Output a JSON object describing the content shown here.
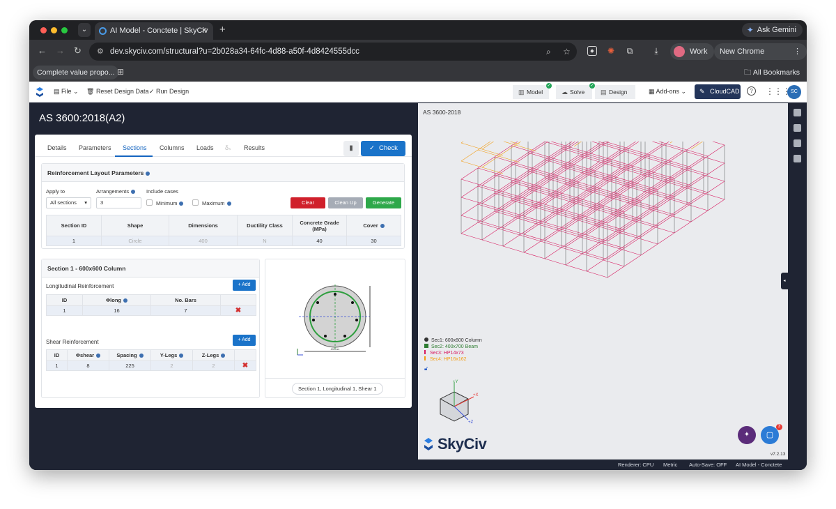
{
  "browser": {
    "tab_title": "AI Model - Conctete | SkyCiv",
    "url": "dev.skyciv.com/structural?u=2b028a34-64fc-4d88-a50f-4d8424555dcc",
    "gemini_label": "Ask Gemini",
    "profile_label": "Work",
    "update_label": "New Chrome available",
    "bookmark_item": "Complete value propo...",
    "all_bookmarks": "All Bookmarks"
  },
  "app_menu": {
    "file": "File",
    "reset": "Reset Design Data",
    "run": "Run Design",
    "model": "Model",
    "solve": "Solve",
    "design": "Design",
    "addons": "Add-ons",
    "cloudcad": "CloudCAD",
    "avatar": "SC"
  },
  "design": {
    "title": "AS 3600:2018(A2)",
    "tabs": [
      "Details",
      "Parameters",
      "Sections",
      "Columns",
      "Loads",
      "δₛ",
      "Results"
    ],
    "check_label": "Check",
    "layout": {
      "header": "Reinforcement Layout Parameters",
      "apply_to_label": "Apply to",
      "apply_to_value": "All sections",
      "arrangements_label": "Arrangements",
      "arrangements_value": "3",
      "include_cases_label": "Include cases",
      "minimum_label": "Minimum",
      "maximum_label": "Maximum",
      "clear_label": "Clear",
      "cleanup_label": "Clean Up",
      "generate_label": "Generate",
      "columns": [
        "Section ID",
        "Shape",
        "Dimensions",
        "Ductility Class",
        "Concrete Grade (MPa)",
        "Cover"
      ],
      "row": [
        "1",
        "Circle",
        "400",
        "N",
        "40",
        "30"
      ]
    },
    "section": {
      "header": "Section 1 - 600x600 Column",
      "long_title": "Longitudinal Reinforcement",
      "add_label": "+ Add",
      "long_cols": [
        "ID",
        "Φlong",
        "No. Bars"
      ],
      "long_row": [
        "1",
        "16",
        "7"
      ],
      "shear_title": "Shear Reinforcement",
      "shear_cols": [
        "ID",
        "Φshear",
        "Spacing",
        "Y-Legs",
        "Z-Legs"
      ],
      "shear_row": [
        "1",
        "8",
        "225",
        "2",
        "2"
      ],
      "preview_caption": "Section 1, Longitudinal 1, Shear 1",
      "preview_dim": "400 mm"
    }
  },
  "viewer": {
    "title": "AS 3600-2018",
    "legend": [
      {
        "label": "Sec1: 600x600 Column",
        "color": "#333333"
      },
      {
        "label": "Sec2: 400x700 Beam",
        "color": "#2e7d32"
      },
      {
        "label": "Sec3: HP14x73",
        "color": "#d81b60"
      },
      {
        "label": "Sec4: HP16x162",
        "color": "#f39c12"
      }
    ],
    "brand": "SkyCiv",
    "version": "v7.2.13",
    "chat_badge": "3"
  },
  "status": [
    "Renderer: CPU",
    "Metric",
    "Auto-Save: OFF",
    "AI Model - Conctete"
  ],
  "colors": {
    "accent": "#1a73c9",
    "clear": "#d0202b",
    "generate": "#2ea84a",
    "cleanup": "#a6acb6",
    "beam_pink": "#d81b60",
    "beam_orange": "#f39c12"
  },
  "icons": [
    "tab-menu-icon",
    "close-icon",
    "plus-icon",
    "back-icon",
    "forward-icon",
    "reload-icon",
    "site-settings-icon",
    "zoom-icon",
    "star-icon",
    "extension-icon",
    "download-icon",
    "more-icon",
    "apps-grid-icon",
    "folder-icon",
    "file-icon",
    "trash-icon",
    "check-icon",
    "cube-icon",
    "cloud-icon",
    "doc-icon",
    "grid-icon",
    "help-icon",
    "eye-icon",
    "rotate-icon",
    "camera-icon",
    "box-icon",
    "wand-icon",
    "chat-icon",
    "lock-icon"
  ]
}
